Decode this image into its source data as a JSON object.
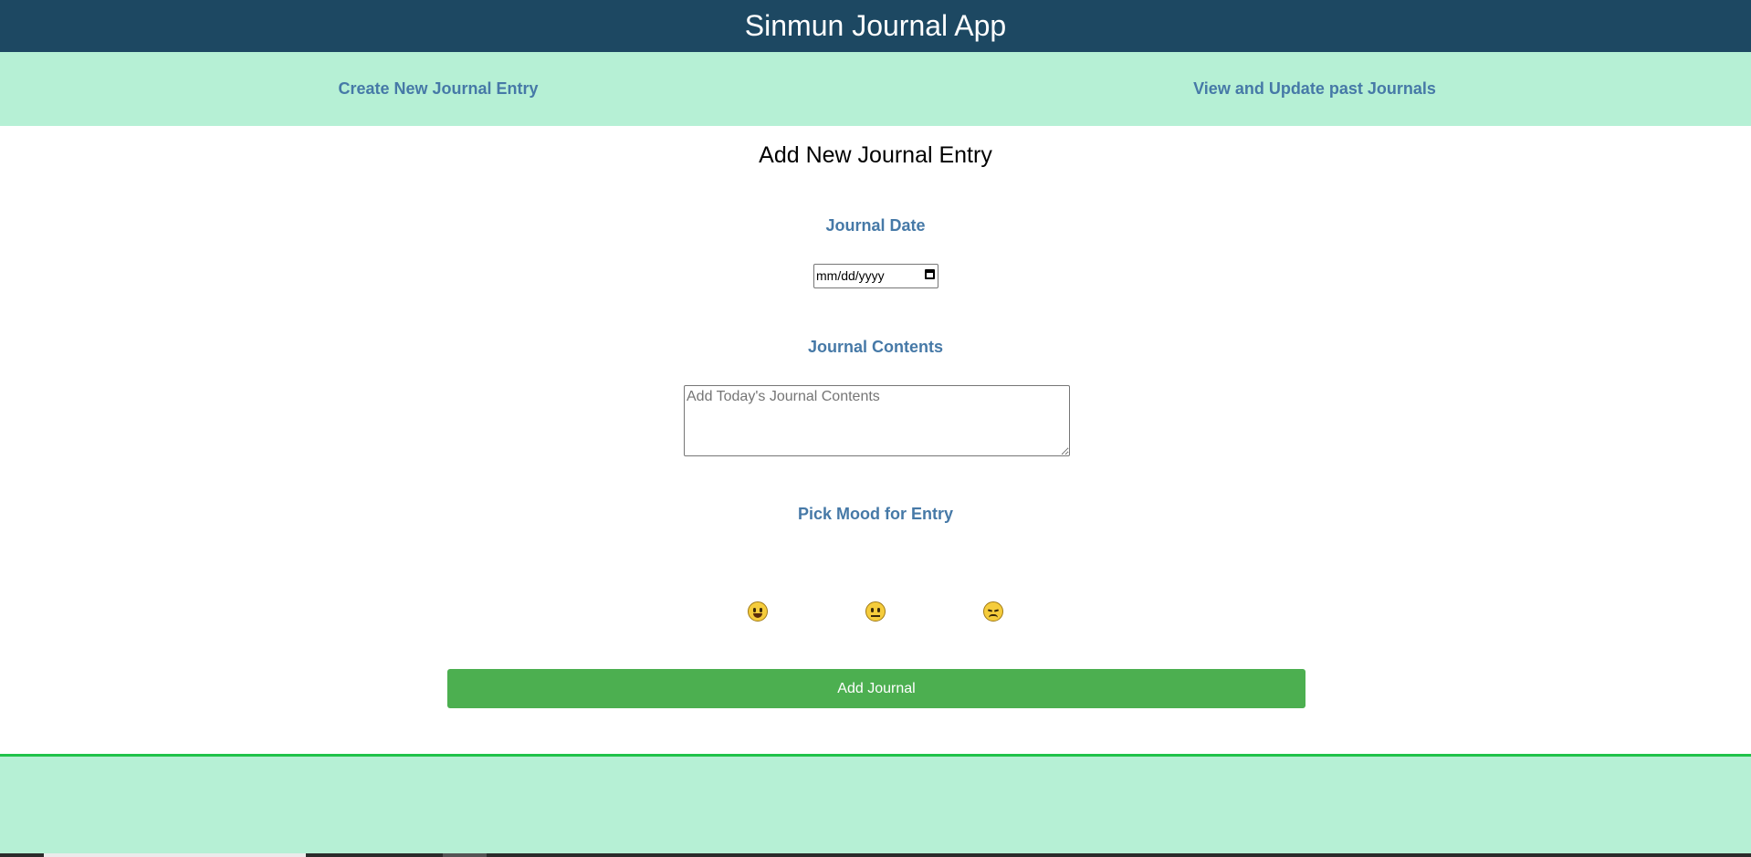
{
  "app": {
    "title": "Sinmun Journal App"
  },
  "nav": {
    "create_label": "Create New Journal Entry",
    "view_label": "View and Update past Journals"
  },
  "form": {
    "title": "Add New Journal Entry",
    "date_label": "Journal Date",
    "date_value": "mm/dd/yyyy",
    "contents_label": "Journal Contents",
    "contents_placeholder": "Add Today's Journal Contents",
    "mood_label": "Pick Mood for Entry",
    "moods": [
      {
        "icon": "grinning-face-icon"
      },
      {
        "icon": "neutral-face-icon"
      },
      {
        "icon": "unamused-face-icon"
      }
    ],
    "submit_label": "Add Journal"
  },
  "colors": {
    "header_bg": "#1d4862",
    "nav_bg": "#b6f0d5",
    "link": "#4679a7",
    "button": "#4caf50",
    "footer_rule": "#1fc24a"
  }
}
